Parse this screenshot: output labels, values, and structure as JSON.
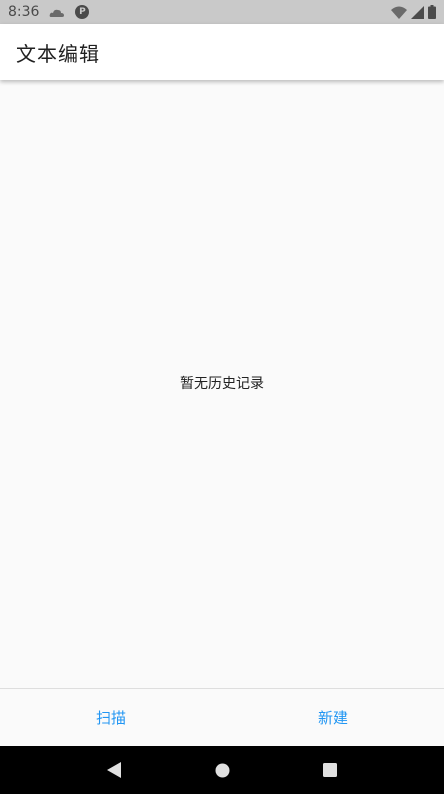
{
  "status_bar": {
    "time": "8:36",
    "icons": [
      "cloud-icon",
      "p-icon",
      "wifi-icon",
      "signal-icon",
      "battery-icon"
    ],
    "p_icon_glyph": "P"
  },
  "app_bar": {
    "title": "文本编辑",
    "background": "#ffffff"
  },
  "content": {
    "empty_message": "暂无历史记录"
  },
  "actions": {
    "scan_label": "扫描",
    "new_label": "新建",
    "accent_color": "#2196f3"
  },
  "nav_bar": {
    "icons": [
      "back-icon",
      "home-icon",
      "recents-icon"
    ]
  }
}
